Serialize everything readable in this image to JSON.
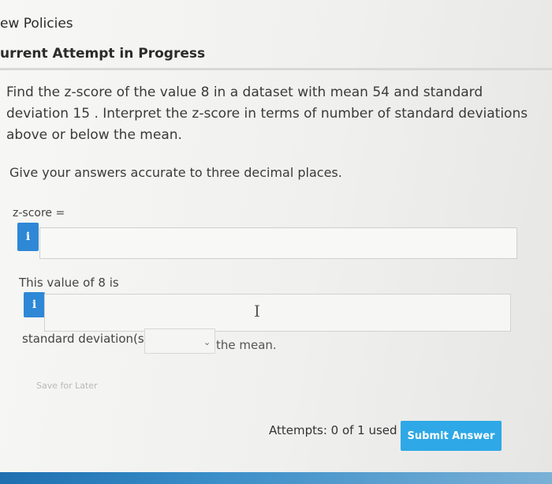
{
  "nav": {
    "policies_link": "ew Policies"
  },
  "attempt": {
    "title": "urrent Attempt in Progress"
  },
  "question": {
    "text": "Find the z-score of the value 8 in a dataset with mean 54 and standard deviation 15 . Interpret the z-score in terms of number of standard deviations above or below the mean.",
    "instruction": "Give your answers accurate to three decimal places."
  },
  "zscore": {
    "label": "z-score =",
    "info": "i",
    "value": ""
  },
  "interpretation": {
    "label": "This value of 8 is",
    "info": "i",
    "value": "",
    "unit_label": "standard deviation(s)",
    "select_value": "",
    "suffix": "the mean."
  },
  "icons": {
    "info": "info-icon",
    "cursor": "text-cursor-icon",
    "chevron": "chevron-down-icon"
  },
  "actions": {
    "save_for_later": "Save for Later",
    "attempts_text": "Attempts: 0 of 1 used",
    "submit": "Submit Answer"
  },
  "colors": {
    "accent": "#2ea8e6",
    "info_button": "#2e88d6"
  }
}
